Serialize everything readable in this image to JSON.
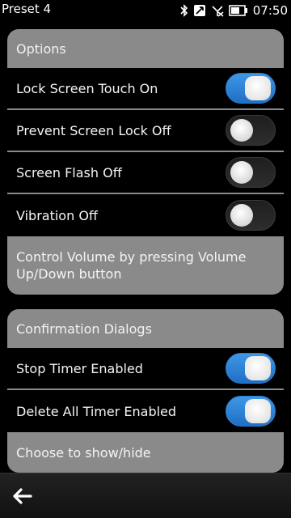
{
  "status": {
    "title": "Preset 4",
    "time": "07:50",
    "icons": [
      "bluetooth-icon",
      "nfc-icon",
      "no-signal-icon",
      "battery-icon"
    ]
  },
  "options_panel": {
    "header": "Options",
    "rows": [
      {
        "label": "Lock Screen Touch On",
        "toggle": "on"
      },
      {
        "label": "Prevent Screen Lock Off",
        "toggle": "off"
      },
      {
        "label": "Screen Flash Off",
        "toggle": "off"
      },
      {
        "label": "Vibration Off",
        "toggle": "off"
      }
    ],
    "footer": "Control Volume by pressing Volume Up/Down button"
  },
  "confirm_panel": {
    "header": "Confirmation Dialogs",
    "rows": [
      {
        "label": "Stop Timer Enabled",
        "toggle": "on"
      },
      {
        "label": "Delete All Timer Enabled",
        "toggle": "on"
      }
    ],
    "footer": "Choose to show/hide"
  },
  "colors": {
    "panel_bg": "#8a8a8a",
    "toggle_on": "#2f86d9",
    "background": "#000000"
  },
  "bottom_bar": {
    "back_icon": "back-arrow-icon"
  }
}
